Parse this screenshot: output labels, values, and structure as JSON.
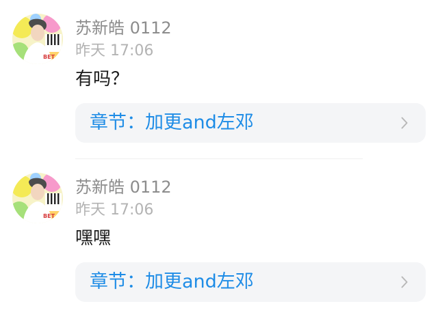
{
  "comments": [
    {
      "username": "苏新皓 0112",
      "timestamp": "昨天 17:06",
      "content": "有吗？",
      "chapter": "章节：加更and左邓",
      "avatar_text": "BET"
    },
    {
      "username": "苏新皓 0112",
      "timestamp": "昨天 17:06",
      "content": "嘿嘿",
      "chapter": "章节：加更and左邓",
      "avatar_text": "BET"
    }
  ],
  "icons": {
    "chevron": "chevron-right-icon"
  },
  "colors": {
    "link_blue": "#1e8ce6",
    "card_bg": "#f4f5f7",
    "username_gray": "#8c8c8c",
    "timestamp_gray": "#b3b3b3",
    "content_text": "#1a1a1a"
  }
}
